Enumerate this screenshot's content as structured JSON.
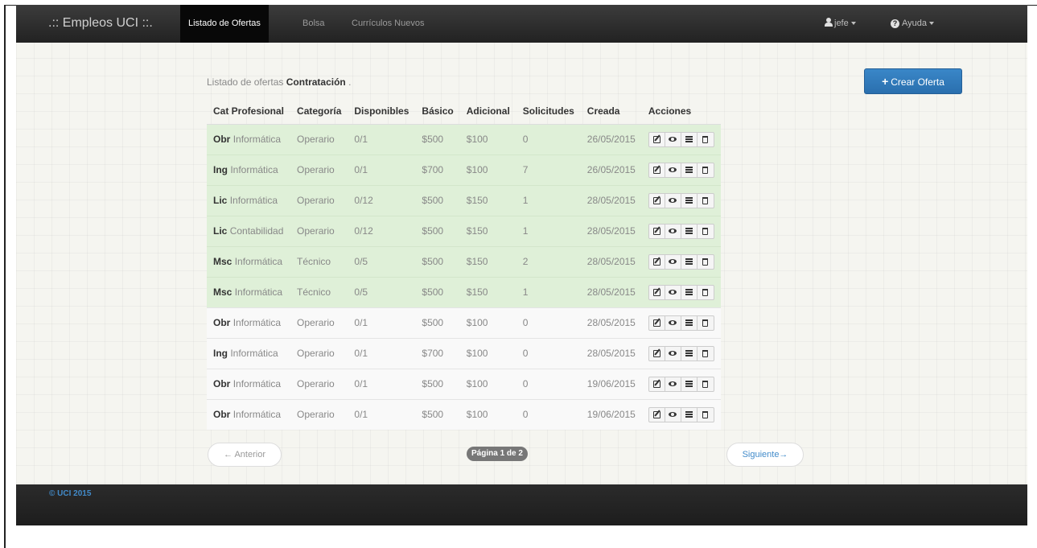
{
  "navbar": {
    "brand": ".:: Empleos UCI ::.",
    "tabs": [
      {
        "label": "Listado de Ofertas"
      },
      {
        "label": "Bolsa"
      },
      {
        "label": "Currículos Nuevos"
      }
    ],
    "user_label": "jefe",
    "help_label": "Ayuda"
  },
  "page": {
    "subtitle_prefix": "Listado de ofertas",
    "subtitle_strong": "Contratación",
    "subtitle_suffix": ".",
    "create_button": "Crear Oferta"
  },
  "table": {
    "headers": [
      "Cat Profesional",
      "Categoría",
      "Disponibles",
      "Básico",
      "Adicional",
      "Solicitudes",
      "Creada",
      "Acciones"
    ],
    "rows": [
      {
        "cat_bold": "Obr",
        "cat_rest": "Informática",
        "categoria": "Operario",
        "disponibles": "0/1",
        "basico": "$500",
        "adicional": "$100",
        "solicitudes": "0",
        "creada": "26/05/2015"
      },
      {
        "cat_bold": "Ing",
        "cat_rest": "Informática",
        "categoria": "Operario",
        "disponibles": "0/1",
        "basico": "$700",
        "adicional": "$100",
        "solicitudes": "7",
        "creada": "26/05/2015"
      },
      {
        "cat_bold": "Lic",
        "cat_rest": "Informática",
        "categoria": "Operario",
        "disponibles": "0/12",
        "basico": "$500",
        "adicional": "$150",
        "solicitudes": "1",
        "creada": "28/05/2015"
      },
      {
        "cat_bold": "Lic",
        "cat_rest": "Contabilidad",
        "categoria": "Operario",
        "disponibles": "0/12",
        "basico": "$500",
        "adicional": "$150",
        "solicitudes": "1",
        "creada": "28/05/2015"
      },
      {
        "cat_bold": "Msc",
        "cat_rest": "Informática",
        "categoria": "Técnico",
        "disponibles": "0/5",
        "basico": "$500",
        "adicional": "$150",
        "solicitudes": "2",
        "creada": "28/05/2015"
      },
      {
        "cat_bold": "Msc",
        "cat_rest": "Informática",
        "categoria": "Técnico",
        "disponibles": "0/5",
        "basico": "$500",
        "adicional": "$150",
        "solicitudes": "1",
        "creada": "28/05/2015"
      },
      {
        "cat_bold": "Obr",
        "cat_rest": "Informática",
        "categoria": "Operario",
        "disponibles": "0/1",
        "basico": "$500",
        "adicional": "$100",
        "solicitudes": "0",
        "creada": "28/05/2015"
      },
      {
        "cat_bold": "Ing",
        "cat_rest": "Informática",
        "categoria": "Operario",
        "disponibles": "0/1",
        "basico": "$700",
        "adicional": "$100",
        "solicitudes": "0",
        "creada": "28/05/2015"
      },
      {
        "cat_bold": "Obr",
        "cat_rest": "Informática",
        "categoria": "Operario",
        "disponibles": "0/1",
        "basico": "$500",
        "adicional": "$100",
        "solicitudes": "0",
        "creada": "19/06/2015"
      },
      {
        "cat_bold": "Obr",
        "cat_rest": "Informática",
        "categoria": "Operario",
        "disponibles": "0/1",
        "basico": "$500",
        "adicional": "$100",
        "solicitudes": "0",
        "creada": "19/06/2015"
      }
    ],
    "highlighted_rows": 6,
    "highlight_color": "#dff0d8"
  },
  "pager": {
    "prev": "← Anterior",
    "page": "Página 1 de 2",
    "next": "Siguiente→"
  },
  "footer": {
    "text": "© UCI 2015"
  },
  "colors": {
    "navbar": "#222222",
    "primary": "#2a6fae",
    "link": "#428bca"
  }
}
